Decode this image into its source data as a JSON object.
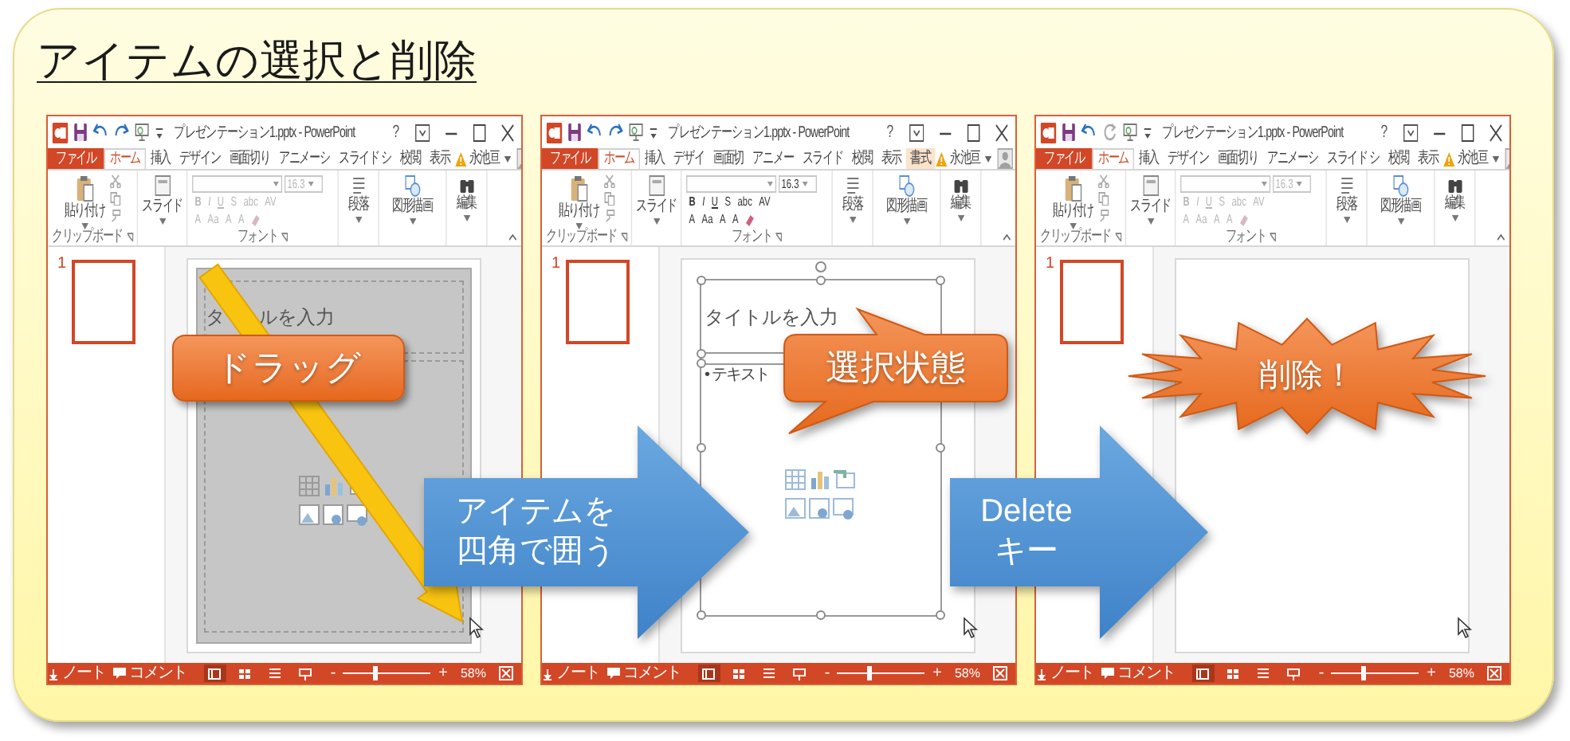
{
  "title": "アイテムの選択と削除",
  "screens": [
    {
      "window_title": "プレゼンテーション1.pptx - PowerPoint",
      "redo_enabled": true,
      "help": "?",
      "tabs": [
        {
          "label": "ファイル",
          "kind": "file",
          "selected": false
        },
        {
          "label": "ホーム",
          "kind": "normal",
          "selected": true
        },
        {
          "label": "挿入",
          "kind": "normal",
          "selected": false
        },
        {
          "label": "デザイン",
          "kind": "normal",
          "selected": false
        },
        {
          "label": "画面切り",
          "kind": "normal",
          "selected": false
        },
        {
          "label": "アニメーシ",
          "kind": "normal",
          "selected": false
        },
        {
          "label": "スライド シ",
          "kind": "normal",
          "selected": false
        },
        {
          "label": "校閲",
          "kind": "normal",
          "selected": false
        },
        {
          "label": "表示",
          "kind": "normal",
          "selected": false
        }
      ],
      "user": "永池亘",
      "ribbon": {
        "paste": "貼り付け",
        "clipboard_label": "クリップボード",
        "new_slide": "スライド",
        "font_size": "16.3",
        "font_enabled": false,
        "font_buttons": [
          "B",
          "I",
          "U",
          "S",
          "abc",
          "AV"
        ],
        "font_buttons_row2": [
          "A",
          "Aa",
          "A",
          "A"
        ],
        "font_label": "フォント",
        "paragraph": "段落",
        "drawing": "図形描画",
        "editing": "編集"
      },
      "slide_number": "1",
      "slide": {
        "kind": "drag",
        "title_parts": [
          "タ",
          "ルを入力"
        ]
      },
      "status_bar": {
        "notes": "ノート",
        "comments": "コメント",
        "views": [
          {
            "kind": "normal",
            "selected": true
          },
          {
            "kind": "sorter",
            "selected": false
          },
          {
            "kind": "reading",
            "selected": false
          },
          {
            "kind": "slideshow",
            "selected": false
          }
        ],
        "zoom_out": "-",
        "zoom_in": "+",
        "zoom_slider": {
          "level": 0.35
        },
        "zoom": "58%"
      }
    },
    {
      "window_title": "プレゼンテーション1.pptx - PowerPoint",
      "redo_enabled": true,
      "help": "?",
      "tabs": [
        {
          "label": "ファイル",
          "kind": "file",
          "selected": false
        },
        {
          "label": "ホーム",
          "kind": "normal",
          "selected": true
        },
        {
          "label": "挿入",
          "kind": "normal",
          "selected": false
        },
        {
          "label": "デザイ",
          "kind": "normal",
          "selected": false
        },
        {
          "label": "画面切",
          "kind": "normal",
          "selected": false
        },
        {
          "label": "アニメー",
          "kind": "normal",
          "selected": false
        },
        {
          "label": "スライド",
          "kind": "normal",
          "selected": false
        },
        {
          "label": "校閲",
          "kind": "normal",
          "selected": false
        },
        {
          "label": "表示",
          "kind": "normal",
          "selected": false
        },
        {
          "label": "書式",
          "kind": "contextual",
          "selected": false
        }
      ],
      "user": "永池亘",
      "ribbon": {
        "paste": "貼り付け",
        "clipboard_label": "クリップボード",
        "new_slide": "スライド",
        "font_size": "16.3",
        "font_enabled": true,
        "font_buttons": [
          "B",
          "I",
          "U",
          "S",
          "abc",
          "AV"
        ],
        "font_buttons_row2": [
          "A",
          "Aa",
          "A",
          "A"
        ],
        "font_label": "フォント",
        "paragraph": "段落",
        "drawing": "図形描画",
        "editing": "編集"
      },
      "slide_number": "1",
      "slide": {
        "kind": "selected",
        "title_parts": [
          "タイトルを入力"
        ],
        "body_text": "• テキスト"
      },
      "status_bar": {
        "notes": "ノート",
        "comments": "コメント",
        "views": [
          {
            "kind": "normal",
            "selected": true
          },
          {
            "kind": "sorter",
            "selected": false
          },
          {
            "kind": "reading",
            "selected": false
          },
          {
            "kind": "slideshow",
            "selected": false
          }
        ],
        "zoom_out": "-",
        "zoom_in": "+",
        "zoom_slider": {
          "level": 0.35
        },
        "zoom": "58%"
      }
    },
    {
      "window_title": "プレゼンテーション1.pptx - PowerPoint",
      "redo_enabled": false,
      "help": "?",
      "tabs": [
        {
          "label": "ファイル",
          "kind": "file",
          "selected": false
        },
        {
          "label": "ホーム",
          "kind": "normal",
          "selected": true
        },
        {
          "label": "挿入",
          "kind": "normal",
          "selected": false
        },
        {
          "label": "デザイン",
          "kind": "normal",
          "selected": false
        },
        {
          "label": "画面切り",
          "kind": "normal",
          "selected": false
        },
        {
          "label": "アニメーシ",
          "kind": "normal",
          "selected": false
        },
        {
          "label": "スライド シ",
          "kind": "normal",
          "selected": false
        },
        {
          "label": "校閲",
          "kind": "normal",
          "selected": false
        },
        {
          "label": "表示",
          "kind": "normal",
          "selected": false
        }
      ],
      "user": "永池亘",
      "ribbon": {
        "paste": "貼り付け",
        "clipboard_label": "クリップボード",
        "new_slide": "スライド",
        "font_size": "16.3",
        "font_enabled": false,
        "font_buttons": [
          "B",
          "I",
          "U",
          "S",
          "abc",
          "AV"
        ],
        "font_buttons_row2": [
          "A",
          "Aa",
          "A",
          "A"
        ],
        "font_label": "フォント",
        "paragraph": "段落",
        "drawing": "図形描画",
        "editing": "編集"
      },
      "slide_number": "1",
      "slide": {
        "kind": "empty"
      },
      "status_bar": {
        "notes": "ノート",
        "comments": "コメント",
        "views": [
          {
            "kind": "normal",
            "selected": true
          },
          {
            "kind": "sorter",
            "selected": false
          },
          {
            "kind": "reading",
            "selected": false
          },
          {
            "kind": "slideshow",
            "selected": false
          }
        ],
        "zoom_out": "-",
        "zoom_in": "+",
        "zoom_slider": {
          "level": 0.35
        },
        "zoom": "58%"
      }
    }
  ],
  "callouts": [
    {
      "kind": "label",
      "text": "ドラッグ"
    },
    {
      "kind": "speech",
      "text": "選択状態"
    },
    {
      "kind": "burst",
      "text": "削除！"
    }
  ],
  "step_arrows": [
    {
      "text": "アイテムを四角で囲う"
    },
    {
      "text": "Delete キー"
    }
  ]
}
